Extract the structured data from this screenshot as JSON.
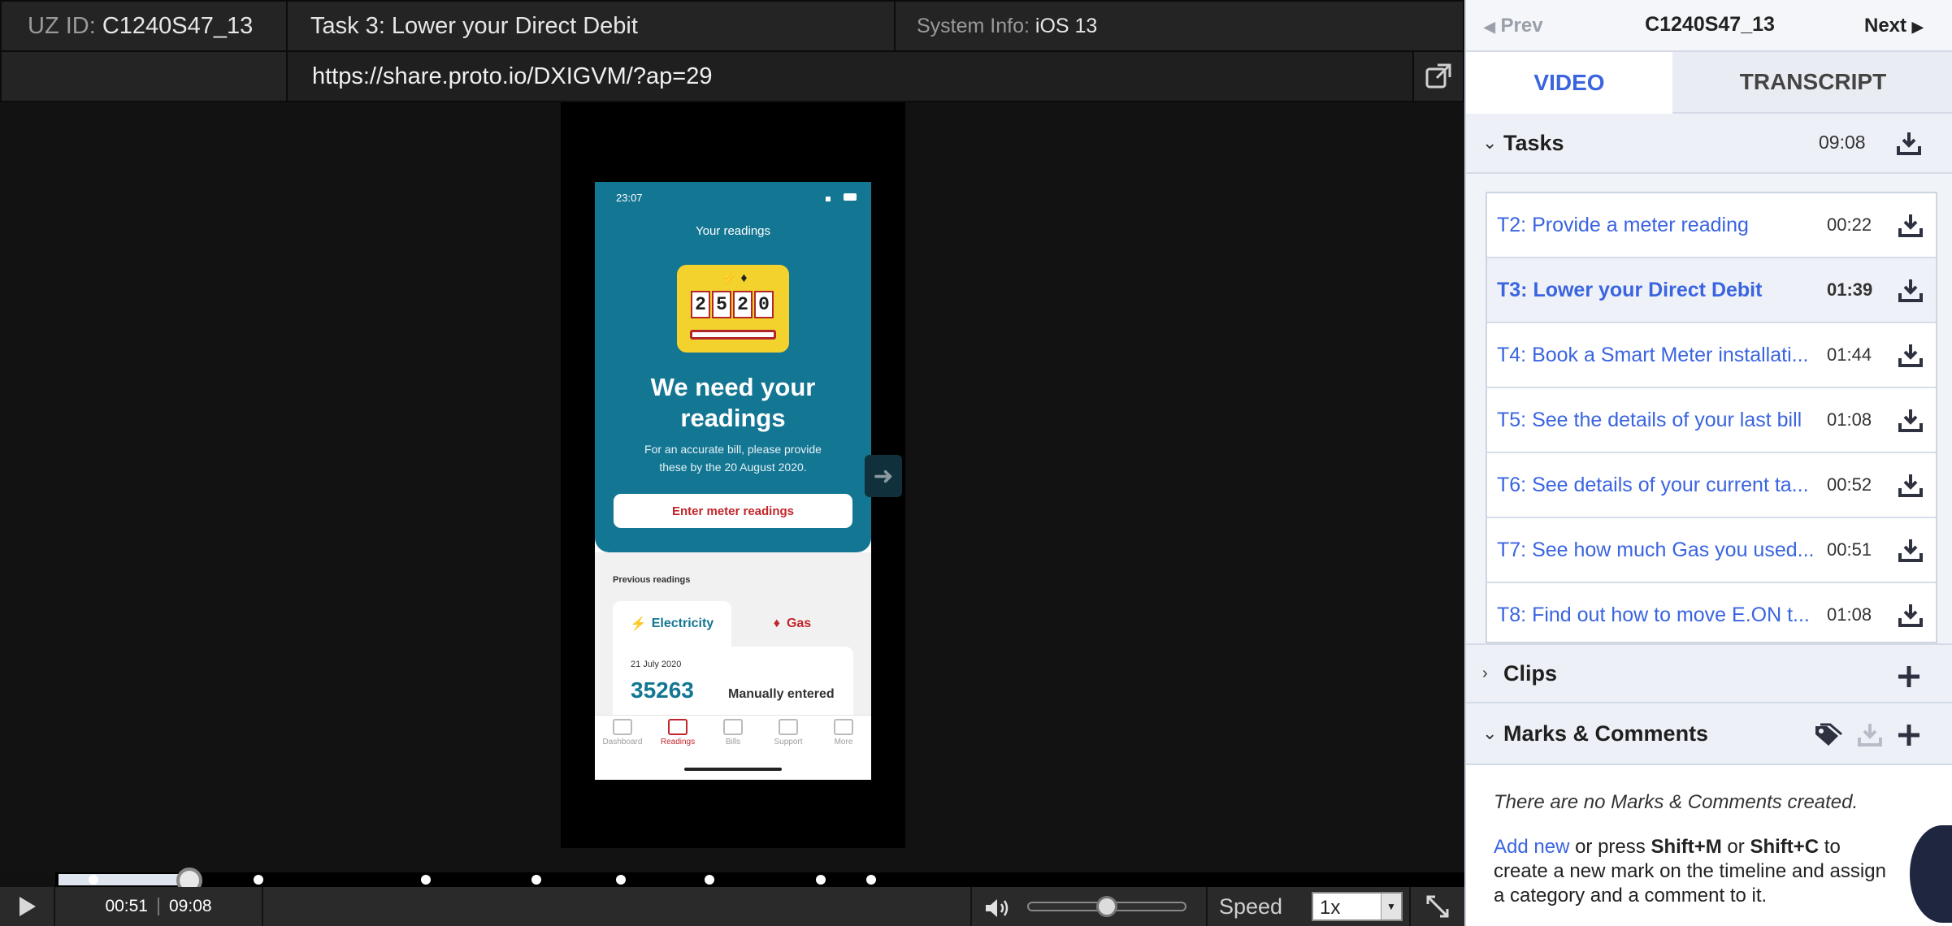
{
  "header": {
    "uz_id_label": "UZ ID:",
    "uz_id_value": "C1240S47_13",
    "task_title": "Task 3: Lower your Direct Debit",
    "system_info_label": "System Info:",
    "system_info_value": "iOS 13",
    "url": "https://share.proto.io/DXIGVM/?ap=29"
  },
  "phone": {
    "status_time": "23:07",
    "screen_title": "Your readings",
    "meter_digits": [
      "2",
      "5",
      "2",
      "0"
    ],
    "headline_line1": "We need your",
    "headline_line2": "readings",
    "subtext_line1": "For an accurate bill, please provide",
    "subtext_line2": "these by the 20 August 2020.",
    "cta": "Enter meter readings",
    "previous_label": "Previous readings",
    "tab_electricity": "Electricity",
    "tab_gas": "Gas",
    "reading_date": "21 July 2020",
    "reading_value": "35263",
    "reading_type": "Manually entered",
    "nav": [
      "Dashboard",
      "Readings",
      "Bills",
      "Support",
      "More"
    ]
  },
  "player": {
    "current_time": "00:51",
    "total_time": "09:08",
    "progress_fraction": 0.093,
    "marker_fractions": [
      0.025,
      0.142,
      0.261,
      0.34,
      0.4,
      0.463,
      0.542,
      0.578
    ],
    "volume_fraction": 0.5,
    "speed_label": "Speed",
    "speed_value": "1x"
  },
  "panel": {
    "prev_label": "Prev",
    "next_label": "Next",
    "session_id": "C1240S47_13",
    "tab_video": "VIDEO",
    "tab_transcript": "TRANSCRIPT",
    "tasks_title": "Tasks",
    "tasks_total": "09:08",
    "tasks": [
      {
        "name": "T2: Provide a meter reading",
        "duration": "00:22"
      },
      {
        "name": "T3: Lower your Direct Debit",
        "duration": "01:39"
      },
      {
        "name": "T4: Book a Smart Meter installati...",
        "duration": "01:44"
      },
      {
        "name": "T5: See the details of your last bill",
        "duration": "01:08"
      },
      {
        "name": "T6: See details of your current ta...",
        "duration": "00:52"
      },
      {
        "name": "T7: See how much Gas you used...",
        "duration": "00:51"
      },
      {
        "name": "T8: Find out how to move E.ON t...",
        "duration": "01:08"
      }
    ],
    "clips_title": "Clips",
    "marks_title": "Marks & Comments",
    "empty_message": "There are no Marks & Comments created.",
    "add_new": "Add new",
    "hint_or_press": " or press ",
    "shortcut_mark": "Shift+M",
    "hint_or": " or ",
    "shortcut_comment": "Shift+C",
    "hint_to": " to",
    "hint_line2": "create a new mark on the timeline and assign",
    "hint_line3": "a category and a comment to it."
  },
  "colors": {
    "accent": "#3a64e0",
    "phone_teal": "#137693",
    "phone_red": "#c2262b",
    "meter_yellow": "#f4d22e"
  },
  "icons": [
    "play-icon",
    "volume-icon",
    "fullscreen-icon",
    "external-link-icon",
    "download-icon",
    "plus-icon",
    "tag-icon",
    "chevron-down-icon",
    "chevron-right-icon",
    "arrow-right-icon"
  ]
}
